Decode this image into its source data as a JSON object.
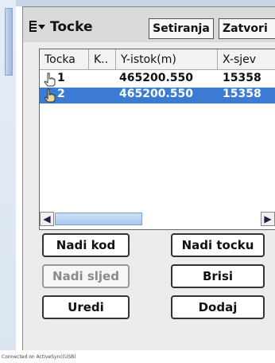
{
  "window": {
    "title": "Tocke"
  },
  "toolbar": {
    "setiranja_label": "Setiranja",
    "zatvori_label": "Zatvori"
  },
  "list": {
    "columns": [
      "Tocka",
      "K..",
      "Y-istok(m)",
      "X-sjev"
    ],
    "rows": [
      {
        "tocka": "1",
        "k": "",
        "y": "465200.550",
        "x": "15358",
        "selected": false
      },
      {
        "tocka": "2",
        "k": "",
        "y": "465200.550",
        "x": "15358",
        "selected": true
      }
    ]
  },
  "buttons": {
    "nadi_kod": "Nadi kod",
    "nadi_tocku": "Nadi tocku",
    "nadi_sljed": "Nadi sljed",
    "brisi": "Brisi",
    "uredi": "Uredi",
    "dodaj": "Dodaj"
  },
  "status": {
    "text": "Connected on ActiveSync(USB)"
  },
  "colors": {
    "selection": "#3b7bd4",
    "title_bar": "#d9d9d9"
  },
  "icons": {
    "menu": "menu-dropdown-icon",
    "row": "pointing-hand-icon"
  }
}
